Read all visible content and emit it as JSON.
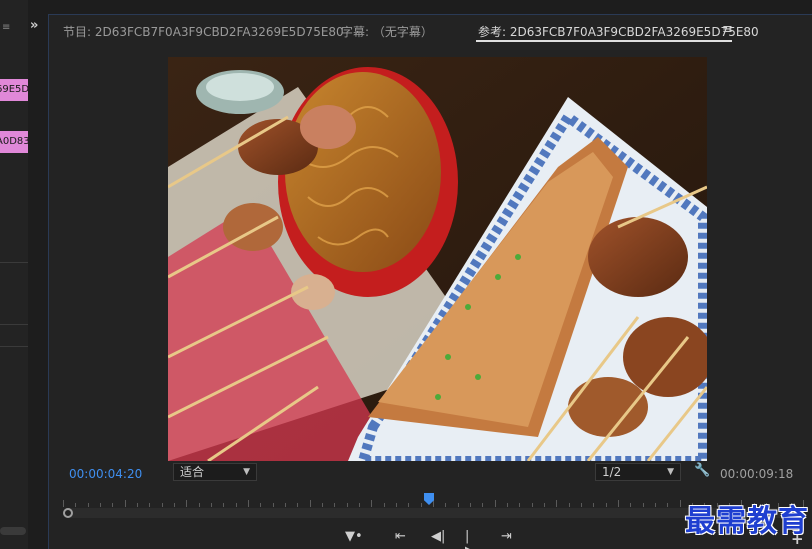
{
  "left_panel": {
    "icon": "≡",
    "clips": [
      "69E5D",
      "A0D83"
    ]
  },
  "expand_icon": "»",
  "tabs": {
    "program": "节目: 2D63FCB7F0A3F9CBD2FA3269E5D75E80",
    "captions": "字幕: （无字幕）",
    "reference": "参考: 2D63FCB7F0A3F9CBD2FA3269E5D75E80",
    "menu_icon": "≡"
  },
  "viewer": {
    "image_description_icon": "video-frame"
  },
  "controls": {
    "current_timecode": "00:00:04:20",
    "zoom_select": "适合",
    "resolution_select": "1/2",
    "duration_timecode": "00:00:09:18",
    "settings_icon": "wrench-icon"
  },
  "transport": {
    "mark_in": "⇤",
    "step_back": "◀|",
    "step_forward": "|▶",
    "go_to_out": "⇥",
    "add": "+"
  },
  "watermark": "最需教育",
  "colors": {
    "accent_blue": "#3f8ff0",
    "clip_pink": "#e088d8",
    "panel_bg": "#232323"
  }
}
